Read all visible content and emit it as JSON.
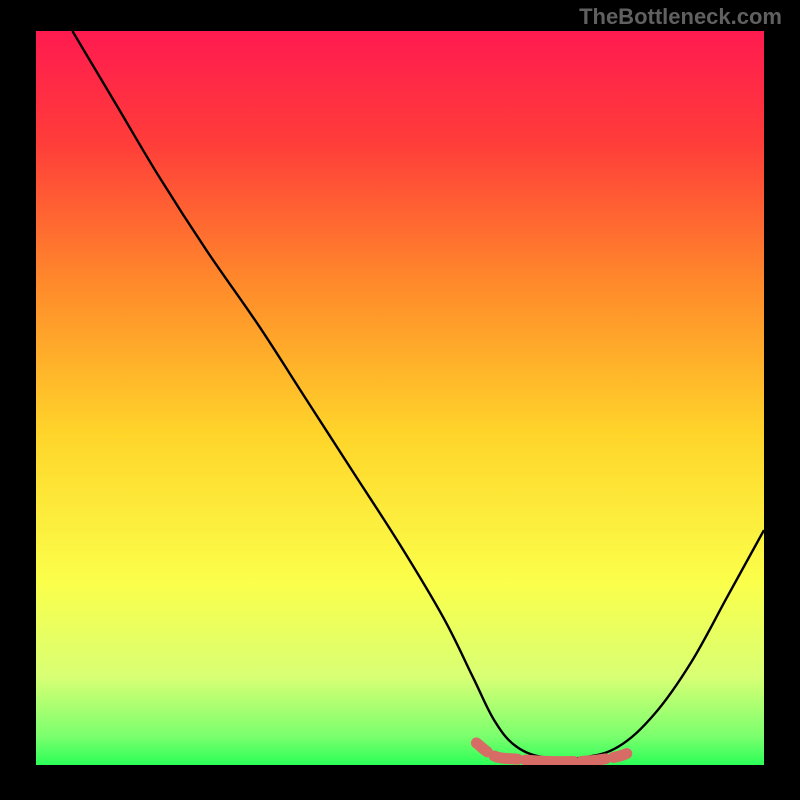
{
  "watermark": "TheBottleneck.com",
  "chart_data": {
    "type": "line",
    "title": "",
    "xlabel": "",
    "ylabel": "",
    "xlim": [
      0,
      100
    ],
    "ylim": [
      0,
      100
    ],
    "gradient_stops": [
      {
        "offset": 0.0,
        "color": "#ff1a4f"
      },
      {
        "offset": 0.15,
        "color": "#ff3c3a"
      },
      {
        "offset": 0.35,
        "color": "#ff8c2a"
      },
      {
        "offset": 0.55,
        "color": "#ffd52a"
      },
      {
        "offset": 0.75,
        "color": "#fbff4a"
      },
      {
        "offset": 0.88,
        "color": "#d8ff74"
      },
      {
        "offset": 0.96,
        "color": "#7cff6e"
      },
      {
        "offset": 1.0,
        "color": "#2bff57"
      }
    ],
    "series": [
      {
        "name": "bottleneck-curve",
        "style": "black-line",
        "points": [
          {
            "x": 5,
            "y": 100
          },
          {
            "x": 11,
            "y": 90
          },
          {
            "x": 17,
            "y": 80
          },
          {
            "x": 23.5,
            "y": 70
          },
          {
            "x": 30.5,
            "y": 60
          },
          {
            "x": 37,
            "y": 50
          },
          {
            "x": 43.5,
            "y": 40
          },
          {
            "x": 50,
            "y": 30
          },
          {
            "x": 56,
            "y": 20
          },
          {
            "x": 60,
            "y": 12
          },
          {
            "x": 63,
            "y": 6
          },
          {
            "x": 66,
            "y": 2.5
          },
          {
            "x": 70,
            "y": 1
          },
          {
            "x": 75,
            "y": 1
          },
          {
            "x": 80,
            "y": 2.5
          },
          {
            "x": 85,
            "y": 7
          },
          {
            "x": 90,
            "y": 14
          },
          {
            "x": 95,
            "y": 23
          },
          {
            "x": 100,
            "y": 32
          }
        ]
      },
      {
        "name": "bottom-flat-region",
        "style": "salmon-rounded",
        "points": [
          {
            "x": 60.5,
            "y": 3
          },
          {
            "x": 63,
            "y": 1.2
          },
          {
            "x": 66,
            "y": 0.8
          },
          {
            "x": 70,
            "y": 0.5
          },
          {
            "x": 75,
            "y": 0.5
          },
          {
            "x": 78,
            "y": 0.8
          },
          {
            "x": 81,
            "y": 1.5
          },
          {
            "x": 83.5,
            "y": 3
          }
        ]
      }
    ]
  }
}
